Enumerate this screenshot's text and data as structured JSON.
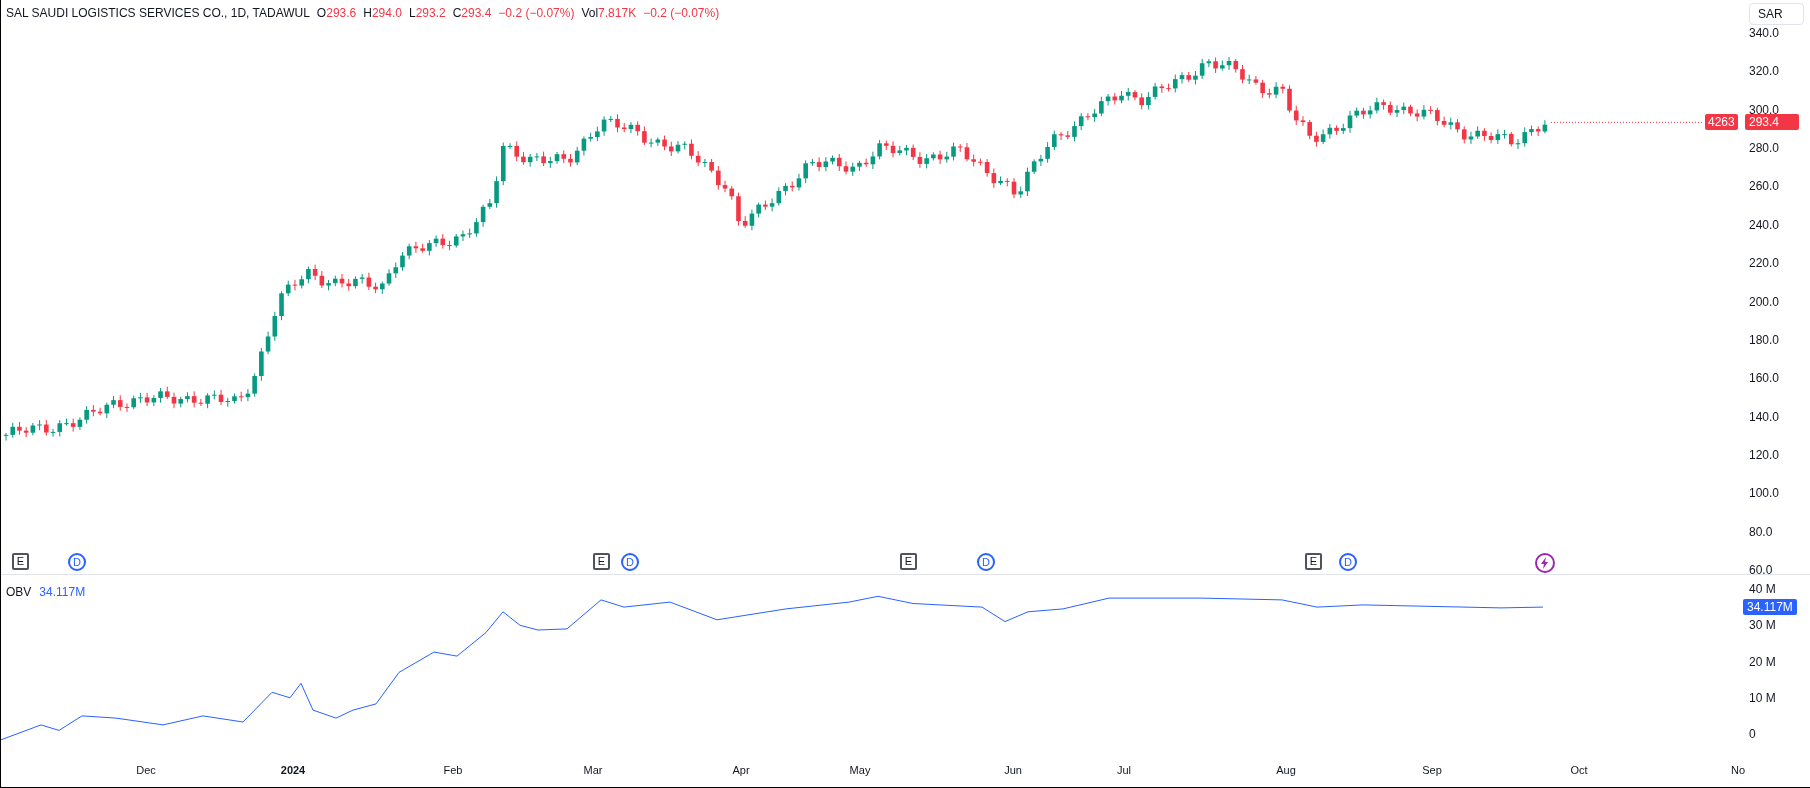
{
  "header": {
    "title": "SAL SAUDI LOGISTICS SERVICES CO., 1D, TADAWUL",
    "ohlc": [
      {
        "label": "O",
        "value": "293.6"
      },
      {
        "label": "H",
        "value": "294.0"
      },
      {
        "label": "L",
        "value": "293.2"
      },
      {
        "label": "C",
        "value": "293.4"
      }
    ],
    "change": "−0.2 (−0.07%)",
    "volume_label": "Vol",
    "volume": "7.817K",
    "volume_change": "−0.2 (−0.07%)"
  },
  "currency": "SAR",
  "price_axis": [
    "340.0",
    "320.0",
    "300.0",
    "280.0",
    "260.0",
    "240.0",
    "220.0",
    "200.0",
    "180.0",
    "160.0",
    "140.0",
    "120.0",
    "100.0",
    "80.0",
    "60.0"
  ],
  "last_price": {
    "countdown": "4263",
    "price": "293.4"
  },
  "events": [
    {
      "kind": "earnings",
      "label": "E"
    },
    {
      "kind": "dividend",
      "label": "D"
    },
    {
      "kind": "earnings",
      "label": "E"
    },
    {
      "kind": "dividend",
      "label": "D"
    },
    {
      "kind": "earnings",
      "label": "E"
    },
    {
      "kind": "dividend",
      "label": "D"
    },
    {
      "kind": "earnings",
      "label": "E"
    },
    {
      "kind": "dividend",
      "label": "D"
    },
    {
      "kind": "flash"
    }
  ],
  "indicator": {
    "name": "OBV",
    "value": "34.117M",
    "badge": "34.117M",
    "axis": [
      "40 M",
      "30 M",
      "20 M",
      "10 M",
      "0"
    ]
  },
  "time_axis": [
    {
      "label": "Dec",
      "kind": "month"
    },
    {
      "label": "2024",
      "kind": "year"
    },
    {
      "label": "Feb",
      "kind": "month"
    },
    {
      "label": "Mar",
      "kind": "month"
    },
    {
      "label": "Apr",
      "kind": "month"
    },
    {
      "label": "May",
      "kind": "month"
    },
    {
      "label": "Jun",
      "kind": "month"
    },
    {
      "label": "Jul",
      "kind": "month"
    },
    {
      "label": "Aug",
      "kind": "month"
    },
    {
      "label": "Sep",
      "kind": "month"
    },
    {
      "label": "Oct",
      "kind": "month"
    },
    {
      "label": "No",
      "kind": "month"
    }
  ]
}
